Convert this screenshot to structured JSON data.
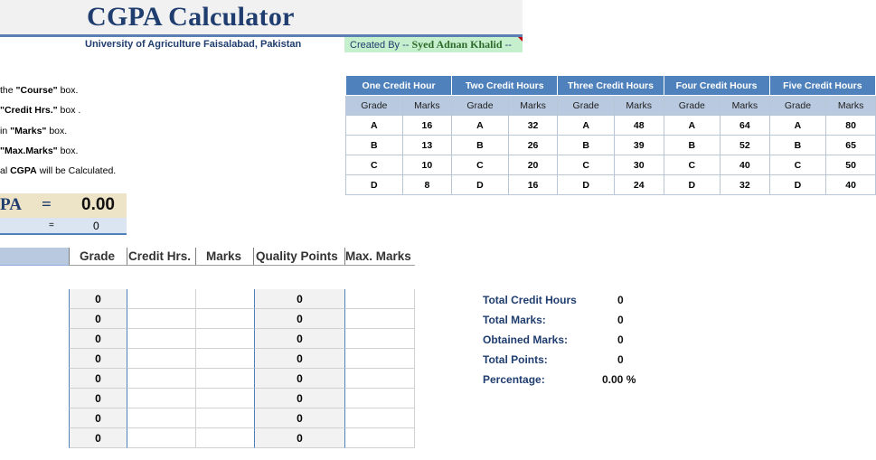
{
  "header": {
    "title": "CGPA Calculator",
    "university": "University of Agriculture Faisalabad, Pakistan",
    "created_by_prefix": "Created By -- ",
    "created_by_name": "Syed Adnan Khalid",
    "created_by_suffix": " --"
  },
  "instructions": [
    {
      "pre": "the ",
      "bold": "\"Course\"",
      "post": " box."
    },
    {
      "pre": "",
      "bold": "\"Credit Hrs.\"",
      "post": " box ."
    },
    {
      "pre": "in ",
      "bold": "\"Marks\"",
      "post": " box."
    },
    {
      "pre": " ",
      "bold": "\"Max.Marks\"",
      "post": " box."
    },
    {
      "pre": "al ",
      "bold": "CGPA",
      "post": " will be Calculated."
    }
  ],
  "reference_table": {
    "groups": [
      "One Credit Hour",
      "Two Credit Hours",
      "Three Credit Hours",
      "Four Credit Hours",
      "Five Credit Hours"
    ],
    "sub_headers": [
      "Grade",
      "Marks"
    ],
    "rows": [
      {
        "grade": "A",
        "marks": [
          "16",
          "32",
          "48",
          "64",
          "80"
        ]
      },
      {
        "grade": "B",
        "marks": [
          "13",
          "26",
          "39",
          "52",
          "65"
        ]
      },
      {
        "grade": "C",
        "marks": [
          "10",
          "20",
          "30",
          "40",
          "50"
        ]
      },
      {
        "grade": "D",
        "marks": [
          "8",
          "16",
          "24",
          "32",
          "40"
        ]
      }
    ]
  },
  "cgpa": {
    "label": "PA",
    "equals": "=",
    "value": "0.00",
    "row2_equals": "=",
    "row2_value": "0"
  },
  "courses": {
    "columns": [
      "Grade",
      "Credit Hrs.",
      "Marks",
      "Quality Points",
      "Max. Marks"
    ],
    "rows": [
      {
        "grade": "0",
        "quality_points": "0"
      },
      {
        "grade": "0",
        "quality_points": "0"
      },
      {
        "grade": "0",
        "quality_points": "0"
      },
      {
        "grade": "0",
        "quality_points": "0"
      },
      {
        "grade": "0",
        "quality_points": "0"
      },
      {
        "grade": "0",
        "quality_points": "0"
      },
      {
        "grade": "0",
        "quality_points": "0"
      },
      {
        "grade": "0",
        "quality_points": "0"
      }
    ]
  },
  "totals": {
    "total_credit_hours_label": "Total Credit Hours",
    "total_credit_hours": "0",
    "total_marks_label": "Total Marks:",
    "total_marks": "0",
    "obtained_marks_label": "Obtained Marks:",
    "obtained_marks": "0",
    "total_points_label": "Total Points:",
    "total_points": "0",
    "percentage_label": "Percentage:",
    "percentage": "0.00 %"
  },
  "colors": {
    "title": "#1f3d6e",
    "header_blue": "#4f81bd",
    "subheader": "#b8c9e0",
    "creator_bg": "#c6efce",
    "cgpa_bg": "#ede3c7"
  }
}
